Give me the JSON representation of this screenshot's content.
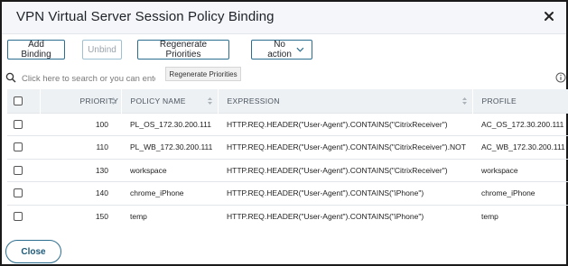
{
  "dialog": {
    "title": "VPN Virtual Server Session Policy Binding"
  },
  "toolbar": {
    "add_binding": "Add Binding",
    "unbind": "Unbind",
    "regenerate": "Regenerate Priorities",
    "action_select": "No action"
  },
  "tooltip": {
    "text": "Regenerate Priorities"
  },
  "search": {
    "placeholder": "Click here to search or you can ente"
  },
  "table": {
    "columns": [
      "PRIORITY",
      "POLICY NAME",
      "EXPRESSION",
      "PROFILE"
    ],
    "rows": [
      {
        "priority": "100",
        "policy_name": "PL_OS_172.30.200.111",
        "expression": "HTTP.REQ.HEADER(\"User-Agent\").CONTAINS(\"CitrixReceiver\")",
        "profile": "AC_OS_172.30.200.111"
      },
      {
        "priority": "110",
        "policy_name": "PL_WB_172.30.200.111",
        "expression": "HTTP.REQ.HEADER(\"User-Agent\").CONTAINS(\"CitrixReceiver\").NOT",
        "profile": "AC_WB_172.30.200.111"
      },
      {
        "priority": "130",
        "policy_name": "workspace",
        "expression": "HTTP.REQ.HEADER(\"User-Agent\").CONTAINS(\"CitrixReceiver\")",
        "profile": "workspace"
      },
      {
        "priority": "140",
        "policy_name": "chrome_iPhone",
        "expression": "HTTP.REQ.HEADER(\"User-Agent\").CONTAINS(\"iPhone\")",
        "profile": "chrome_iPhone"
      },
      {
        "priority": "150",
        "policy_name": "temp",
        "expression": "HTTP.REQ.HEADER(\"User-Agent\").CONTAINS(\"iPhone\")",
        "profile": "temp"
      }
    ]
  },
  "footer": {
    "close": "Close"
  },
  "icons": {
    "close": "close-icon",
    "search": "search-icon",
    "info": "info-icon",
    "dropdown": "chevron-down-icon",
    "sort": "sort-icon"
  },
  "colors": {
    "accent": "#2c6e8f",
    "header_bg": "#f4f6f9",
    "table_header_bg": "#eef1f4"
  }
}
